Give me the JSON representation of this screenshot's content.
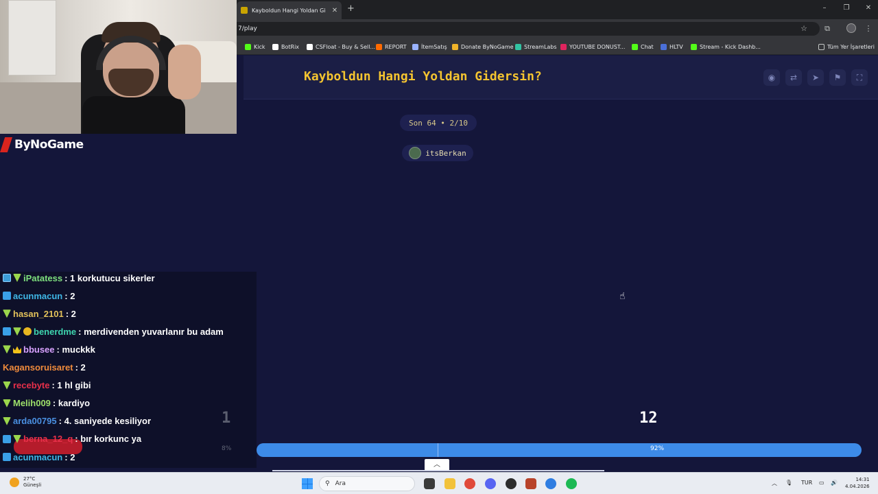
{
  "browser": {
    "tab_title": "Kayboldun Hangi Yoldan Gidersin",
    "new_tab": "+",
    "url": "7/play",
    "bookmarks": [
      {
        "label": "Kick",
        "color": "#53fc18"
      },
      {
        "label": "BotRix",
        "color": "#ffffff"
      },
      {
        "label": "CSFloat - Buy & Sell...",
        "color": "#ffffff"
      },
      {
        "label": "REPORT",
        "color": "#ff6a00"
      },
      {
        "label": "İtemSatış",
        "color": "#9ab3ff"
      },
      {
        "label": "Donate ByNoGame",
        "color": "#f0b429"
      },
      {
        "label": "StreamLabs",
        "color": "#31c3a2"
      },
      {
        "label": "YOUTUBE DONUST...",
        "color": "#e0245e"
      },
      {
        "label": "Chat",
        "color": "#53fc18"
      },
      {
        "label": "HLTV",
        "color": "#4a6fd8"
      },
      {
        "label": "Stream - Kick Dashb...",
        "color": "#53fc18"
      }
    ],
    "all_bookmarks": "Tüm Yer İşaretleri"
  },
  "game": {
    "title": "Kayboldun Hangi Yoldan Gidersin?",
    "round": "Son 64 • 2/10",
    "user": "itsBerkan",
    "left_count": "1",
    "right_count": "12",
    "left_percent": "8%",
    "right_percent": "92%",
    "left_fraction": 0.08,
    "header_icons": [
      "eye-icon",
      "share-icon",
      "send-icon",
      "flag-icon",
      "fullscreen-icon"
    ]
  },
  "overlay": {
    "brand": "ByNoGame"
  },
  "chat": [
    {
      "user": "iPatatess",
      "color": "#7ee07e",
      "msg": ": 1 korkutucu sikerler",
      "badges": [
        "mod",
        "green"
      ]
    },
    {
      "user": "acunmacun",
      "color": "#3fb7e6",
      "msg": ": 2",
      "badges": [
        "blue"
      ]
    },
    {
      "user": "hasan_2101",
      "color": "#e2c15a",
      "msg": ": 2",
      "badges": [
        "green"
      ]
    },
    {
      "user": "benerdme",
      "color": "#3fd6b0",
      "msg": ": merdivenden yuvarlanır bu adam",
      "badges": [
        "blue",
        "green",
        "gold"
      ]
    },
    {
      "user": "bbusee",
      "color": "#d8a1ff",
      "msg": ": muckkk",
      "badges": [
        "green",
        "crown"
      ]
    },
    {
      "user": "Kagansoruisaret",
      "color": "#f08b3c",
      "msg": ": 2",
      "badges": []
    },
    {
      "user": "recebyte",
      "color": "#e8304a",
      "msg": ": 1 hl gibi",
      "badges": [
        "green"
      ]
    },
    {
      "user": "Melih009",
      "color": "#9ee06a",
      "msg": ": kardiyo",
      "badges": [
        "green"
      ]
    },
    {
      "user": "arda00795",
      "color": "#4a90e2",
      "msg": ": 4. saniyede kesiliyor",
      "badges": [
        "green"
      ]
    },
    {
      "user": "berna_12_q",
      "color": "#e8304a",
      "msg": ": bır korkunc ya",
      "badges": [
        "blue",
        "green"
      ]
    },
    {
      "user": "acunmacun",
      "color": "#3fb7e6",
      "msg": ": 2",
      "badges": [
        "blue"
      ]
    }
  ],
  "taskbar": {
    "temp": "27°C",
    "weather": "Güneşli",
    "search_placeholder": "Ara",
    "lang": "TUR",
    "time": "14:31",
    "date": "4.04.2026"
  }
}
